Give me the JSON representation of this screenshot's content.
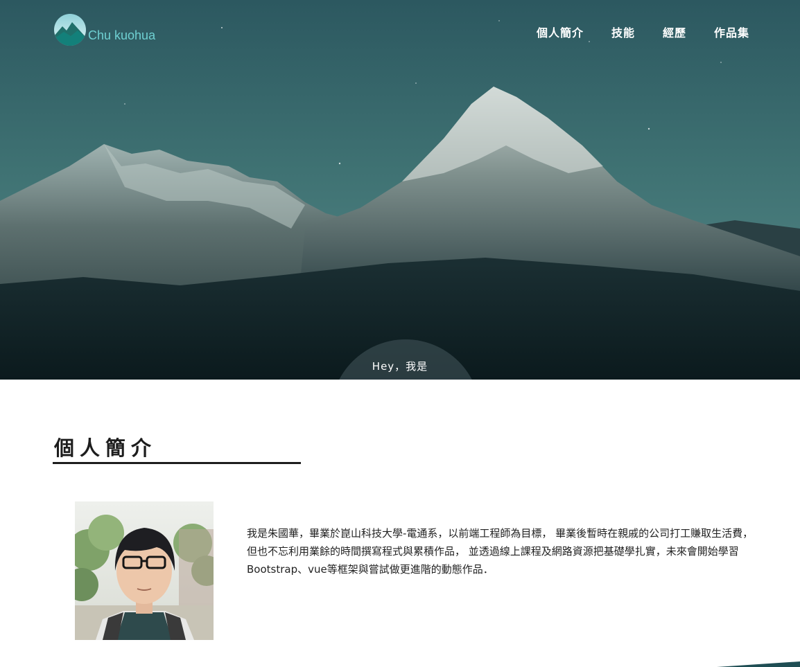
{
  "header": {
    "logo_text": "Chu kuohua",
    "logo_icon": "mountain-logo-icon",
    "nav": [
      {
        "label": "個人簡介"
      },
      {
        "label": "技能"
      },
      {
        "label": "經歷"
      },
      {
        "label": "作品集"
      }
    ]
  },
  "hero": {
    "greeting": "Hey，我是"
  },
  "about": {
    "title": "個人簡介",
    "intro": "我是朱國華，畢業於崑山科技大學-電通系，以前端工程師為目標， 畢業後暫時在親戚的公司打工賺取生活費，但也不忘利用業餘的時間撰寫程式與累積作品， 並透過線上課程及網路資源把基礎學扎實，未來會開始學習Bootstrap、vue等框架與嘗試做更進階的動態作品．"
  },
  "colors": {
    "accent": "#6fd0d2",
    "brand_dark": "#1f4e54",
    "text": "#222222"
  }
}
